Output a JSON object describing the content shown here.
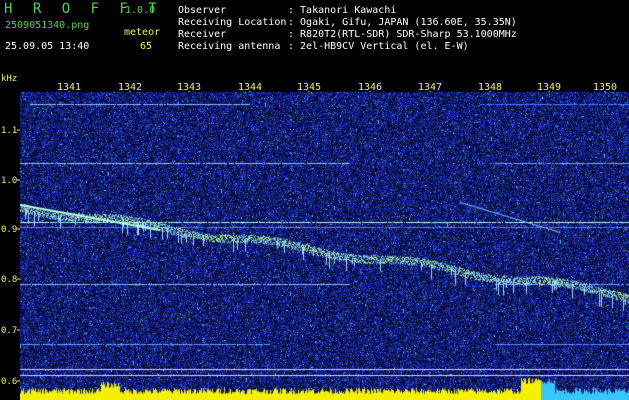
{
  "header": {
    "app_title": "H R O F F T",
    "version": "1.0.0",
    "filename": "2509051340.png",
    "type_label": "meteor",
    "datetime": "25.09.05 13:40",
    "count": "65"
  },
  "info": [
    {
      "label": "Observer",
      "value": ": Takanori Kawachi"
    },
    {
      "label": "Receiving Location",
      "value": ": Ogaki, Gifu, JAPAN (136.60E, 35.35N)"
    },
    {
      "label": "Receiver",
      "value": ": R820T2(RTL-SDR) SDR-Sharp 53.1000MHz"
    },
    {
      "label": "Receiving antenna",
      "value": ": 2el-HB9CV Vertical (el. E-W)"
    }
  ],
  "axes": {
    "y_unit": "kHz",
    "x_ticks": [
      "1341",
      "1342",
      "1343",
      "1344",
      "1345",
      "1346",
      "1347",
      "1348",
      "1349",
      "1350"
    ],
    "y_ticks": [
      "1.1",
      "1.0",
      "0.9",
      "0.8",
      "0.7",
      "0.6"
    ]
  },
  "colors": {
    "background": "#000000",
    "noise": "#1a2bd0",
    "header_green": "#46d64a",
    "header_yellow": "#f4f04a",
    "trace": "#b8ff8a",
    "meter_yellow": "#f4f000",
    "meter_cyan": "#36c7ff"
  }
}
